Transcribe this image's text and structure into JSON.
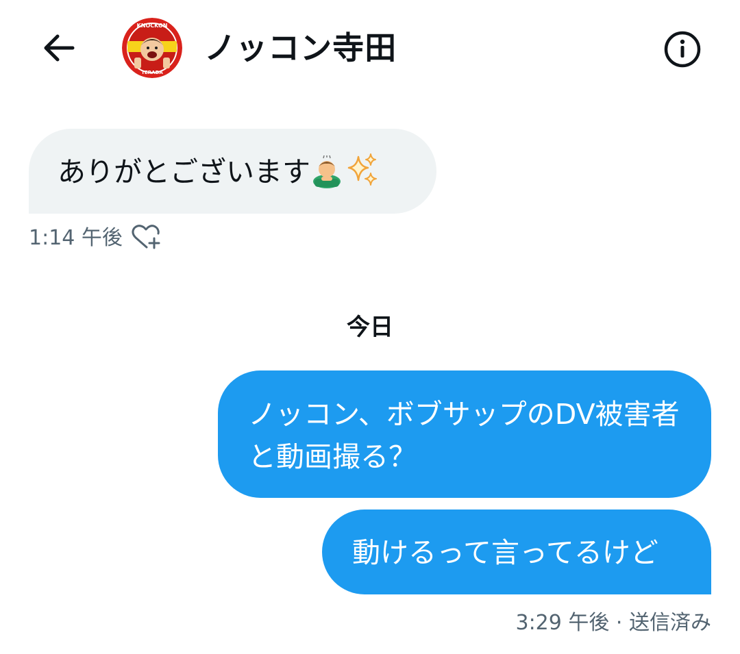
{
  "header": {
    "title": "ノッコン寺田",
    "back_icon": "arrow-left-icon",
    "info_icon": "info-circle-icon",
    "avatar": {
      "badge_top": "KNOCKON",
      "badge_bottom": "TERADA",
      "colors": {
        "ring": "#d9221c",
        "badge": "#f7d21b"
      }
    }
  },
  "messages": [
    {
      "direction": "received",
      "text": "ありがとございます",
      "emojis": [
        "man-bowing-emoji",
        "sparkles-emoji"
      ],
      "time": "1:14 午後",
      "like_icon": "heart-plus-icon"
    },
    {
      "direction": "sent",
      "text": "ノッコン、ボブサップのDV被害者と動画撮る？"
    },
    {
      "direction": "sent",
      "text": "動けるって言ってるけど",
      "time": "3:29 午後 · 送信済み"
    }
  ],
  "date_separator": "今日",
  "colors": {
    "sent_bubble": "#1d9bf0",
    "received_bubble": "#eff3f4",
    "meta_text": "#536471",
    "text": "#0f1419"
  }
}
